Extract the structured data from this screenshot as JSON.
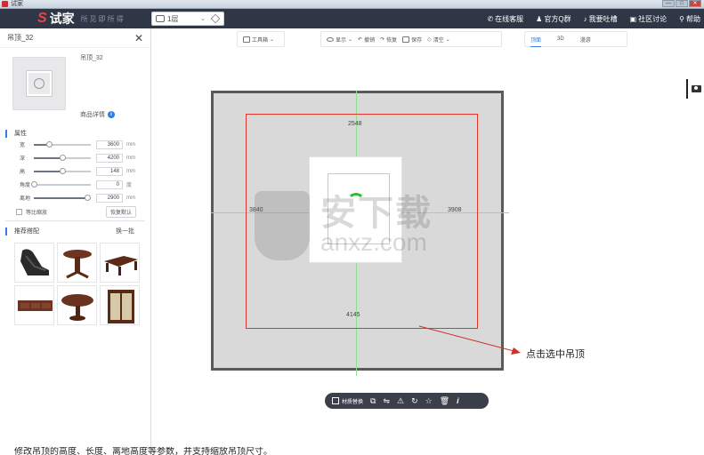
{
  "window": {
    "title": "试家",
    "controls": [
      "—",
      "□",
      "✕"
    ]
  },
  "brand": {
    "name": "试家",
    "slogan": "所见即所得"
  },
  "floor_selector": {
    "value": "1层"
  },
  "nav_links": [
    {
      "label": "在线客服",
      "icon": "phone-icon"
    },
    {
      "label": "官方Q群",
      "icon": "user-icon"
    },
    {
      "label": "我要吐槽",
      "icon": "mic-icon"
    },
    {
      "label": "社区讨论",
      "icon": "forum-icon"
    },
    {
      "label": "帮助",
      "icon": "help-icon"
    }
  ],
  "panel": {
    "title": "吊顶_32",
    "product_name": "吊顶_32",
    "detail_link": "商品详情",
    "attr_title": "属性",
    "props": [
      {
        "label": "宽",
        "value": "3600",
        "unit": "mm",
        "level": 0.28
      },
      {
        "label": "深",
        "value": "4200",
        "unit": "mm",
        "level": 0.5
      },
      {
        "label": "高",
        "value": "148",
        "unit": "mm",
        "level": 0.5
      },
      {
        "label": "角度",
        "value": "0",
        "unit": "度",
        "level": 0.0
      },
      {
        "label": "离地",
        "value": "2900",
        "unit": "mm",
        "level": 0.95
      }
    ],
    "lock_label": "等比缩放",
    "reset_label": "恢复默认",
    "recommend_title": "推荐搭配",
    "swap_label": "换一批"
  },
  "toolbar": {
    "tool_library": "工具箱",
    "items": [
      "显示",
      "撤销",
      "恢复",
      "保存",
      "清空"
    ],
    "views": [
      "顶面",
      "3D",
      "漫游"
    ],
    "active_view": "顶面"
  },
  "canvas": {
    "dim_top": "2548",
    "dim_bottom": "4145",
    "dim_left": "3840",
    "dim_right": "3908",
    "annotation": "点击选中吊顶"
  },
  "bottom_toolbar": {
    "lead_label": "材质替换"
  },
  "watermark": {
    "text": "安下载",
    "domain": "anxz.com"
  },
  "caption": "修改吊顶的高度、长度、离地高度等参数，并支持缩放吊顶尺寸。"
}
